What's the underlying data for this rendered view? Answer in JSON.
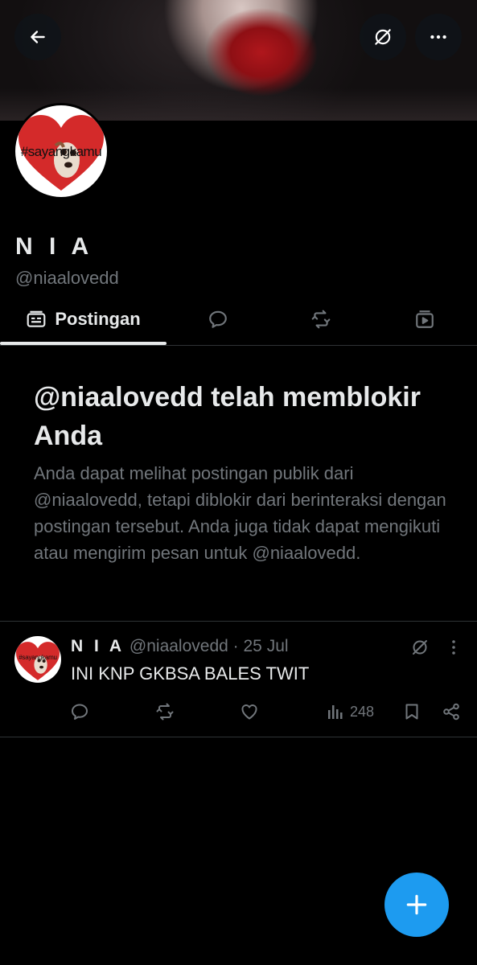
{
  "profile": {
    "name": "N I A",
    "handle": "@niaalovedd",
    "avatar_text": "#sayangkamu"
  },
  "tabs": [
    {
      "label": "Postingan",
      "icon": "posts-icon",
      "active": true
    },
    {
      "label": "",
      "icon": "replies-icon"
    },
    {
      "label": "",
      "icon": "retweet-icon"
    },
    {
      "label": "",
      "icon": "media-icon"
    }
  ],
  "blocked": {
    "title": "@niaalovedd telah memblokir Anda",
    "text": "Anda dapat melihat postingan publik dari @niaalovedd, tetapi diblokir dari berinteraksi dengan postingan tersebut. Anda juga tidak dapat mengikuti atau mengirim pesan untuk @niaalovedd."
  },
  "post": {
    "name": "N I A",
    "handle": "@niaalovedd",
    "separator": "·",
    "date": "25 Jul",
    "text": "INI KNP GKBSA BALES TWIT",
    "views": "248"
  },
  "colors": {
    "background": "#000000",
    "text_primary": "#e7e9ea",
    "text_secondary": "#71767b",
    "divider": "#2f3336",
    "accent": "#1d9bf0",
    "heart_red": "#d42a2a"
  }
}
